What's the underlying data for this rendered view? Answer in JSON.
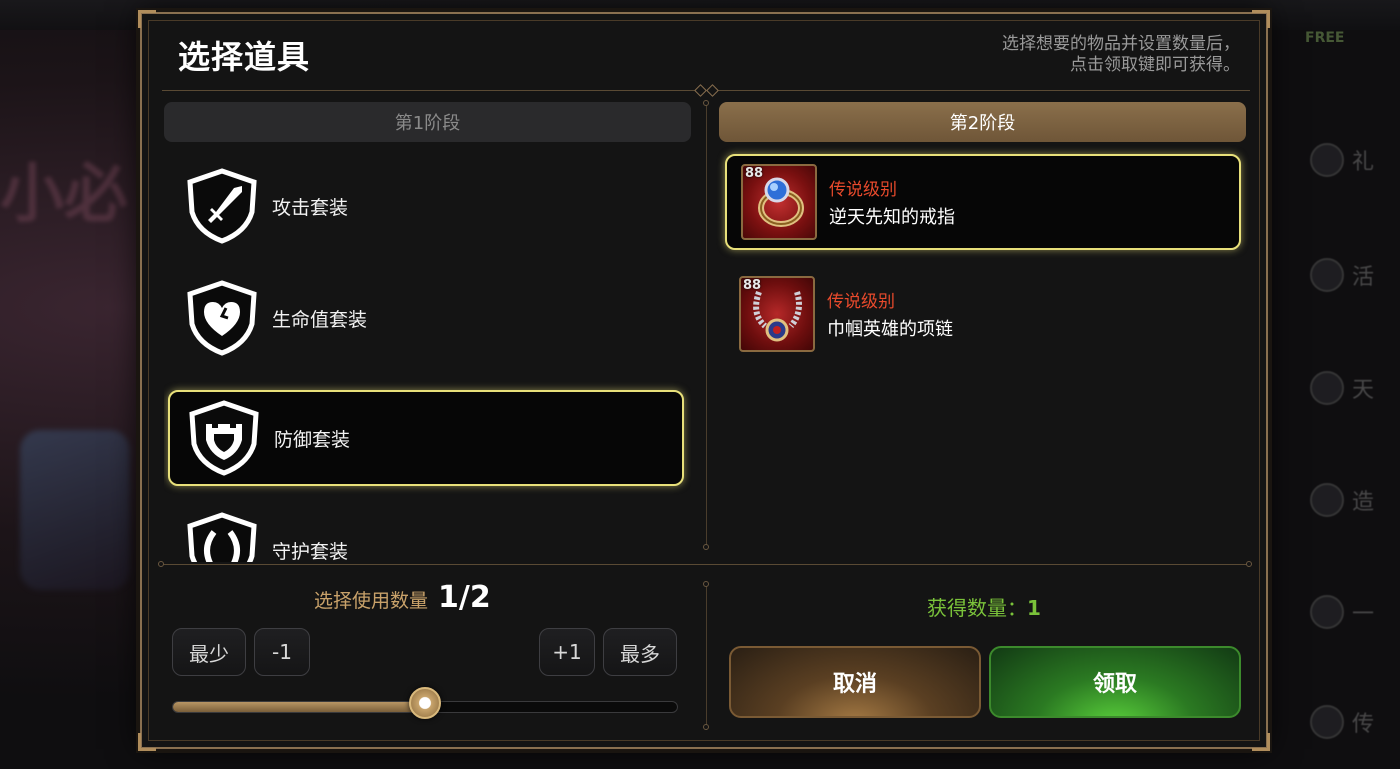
{
  "dialog": {
    "title": "选择道具",
    "hint_line1": "选择想要的物品并设置数量后，",
    "hint_line2": "点击领取键即可获得。"
  },
  "stages": {
    "stage1": "第1阶段",
    "stage2": "第2阶段"
  },
  "left_list": {
    "items": [
      {
        "label": "攻击套装",
        "icon": "sword-shield-icon",
        "selected": false
      },
      {
        "label": "生命值套装",
        "icon": "heart-shield-icon",
        "selected": false
      },
      {
        "label": "防御套装",
        "icon": "castle-shield-icon",
        "selected": true
      },
      {
        "label": "守护套装",
        "icon": "guard-shield-icon",
        "selected": false
      }
    ]
  },
  "right_list": {
    "items": [
      {
        "grade": "传说级别",
        "name": "逆天先知的戒指",
        "level": "88",
        "icon": "ring-icon",
        "selected": true
      },
      {
        "grade": "传说级别",
        "name": "巾帼英雄的项链",
        "level": "88",
        "icon": "necklace-icon",
        "selected": false
      }
    ]
  },
  "quantity": {
    "label": "选择使用数量",
    "value": "1/2",
    "min_label": "最少",
    "minus_label": "-1",
    "plus_label": "+1",
    "max_label": "最多",
    "slider_fraction": 0.5
  },
  "obtain": {
    "label": "获得数量：",
    "count": "1"
  },
  "buttons": {
    "cancel": "取消",
    "confirm": "领取"
  },
  "background": {
    "left_text": "小必",
    "free_badge": "FREE",
    "right_labels": [
      "礼",
      "活",
      "天",
      "造",
      "一",
      "传"
    ]
  },
  "colors": {
    "accent_gold": "#8a6f4b",
    "selected_border": "#e8e07a",
    "grade_red": "#e84a2c",
    "obtain_green": "#7ac23a"
  }
}
